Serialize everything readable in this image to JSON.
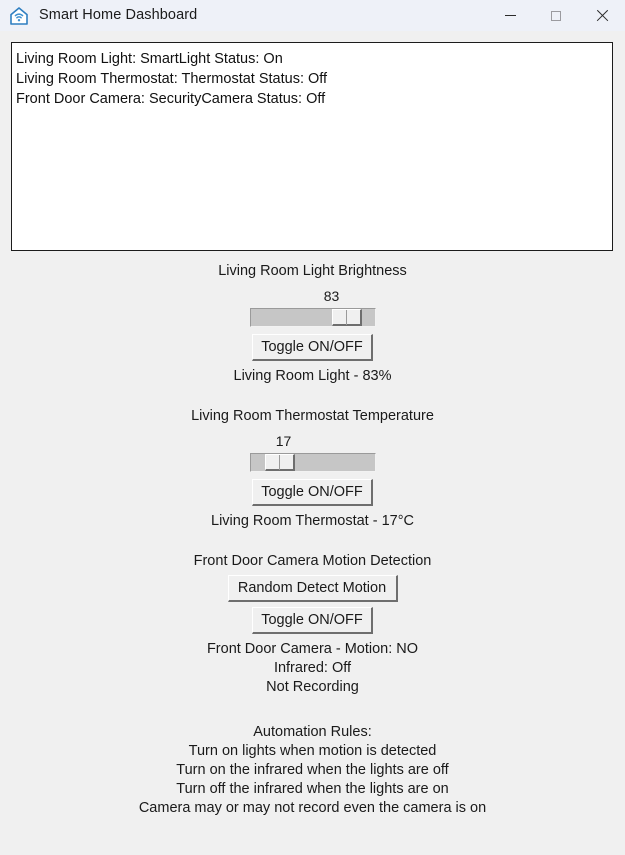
{
  "window": {
    "title": "Smart Home Dashboard",
    "icon": "smart-home-icon",
    "bg_color": "#f0f0f0",
    "titlebar_color": "#eef1f8",
    "controls": {
      "minimize": "minimize-icon",
      "maximize": "maximize-icon",
      "close": "close-icon"
    }
  },
  "status_log": {
    "lines": [
      "Living Room Light: SmartLight Status: On",
      "Living Room Thermostat: Thermostat Status: Off",
      "Front Door Camera: SecurityCamera Status: Off"
    ]
  },
  "light_section": {
    "title": "Living Room Light Brightness",
    "scale_value": "83",
    "scale_min": 0,
    "scale_max": 100,
    "toggle_label": "Toggle ON/OFF",
    "status": "Living Room Light - 83%"
  },
  "thermostat_section": {
    "title": "Living Room Thermostat Temperature",
    "scale_value": "17",
    "scale_min": 10,
    "scale_max": 30,
    "toggle_label": "Toggle ON/OFF",
    "status": "Living Room Thermostat - 17°C"
  },
  "camera_section": {
    "title": "Front Door Camera Motion Detection",
    "random_label": "Random Detect Motion",
    "toggle_label": "Toggle ON/OFF",
    "status_lines": [
      "Front Door Camera - Motion: NO",
      "Infrared: Off",
      "Not Recording"
    ]
  },
  "automation": {
    "heading": "Automation Rules:",
    "rules": [
      "Turn on lights when motion is detected",
      "Turn on the infrared when the lights are off",
      "Turn off the infrared when the lights are on",
      "Camera may or may not record even the camera is on"
    ]
  }
}
